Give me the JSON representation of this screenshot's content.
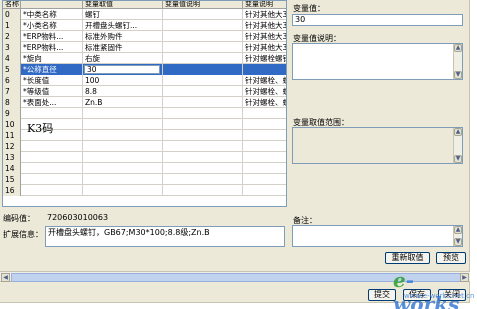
{
  "grid": {
    "columns": [
      "名称",
      "变量取值",
      "变量值说明",
      "变量说明"
    ],
    "rows": [
      {
        "num": "0",
        "name": "*中类名称",
        "value": "螺钉",
        "value_desc": "",
        "var_desc": "针对其他大3"
      },
      {
        "num": "1",
        "name": "*小类名称",
        "value": "开槽盘头螺钉...",
        "value_desc": "",
        "var_desc": "针对其他大3"
      },
      {
        "num": "2",
        "name": "*ERP物料...",
        "value": "标准外购件",
        "value_desc": "",
        "var_desc": "针对其他大3"
      },
      {
        "num": "3",
        "name": "*ERP物料...",
        "value": "标准紧固件",
        "value_desc": "",
        "var_desc": "针对其他大3"
      },
      {
        "num": "4",
        "name": "*旋向",
        "value": "右旋",
        "value_desc": "",
        "var_desc": "针对螺栓螺钉"
      },
      {
        "num": "5",
        "name": "*公称直径",
        "value": "30",
        "value_desc": "",
        "var_desc": ""
      },
      {
        "num": "6",
        "name": "*长度值",
        "value": "100",
        "value_desc": "",
        "var_desc": "针对螺栓、螺"
      },
      {
        "num": "7",
        "name": "*等级值",
        "value": "8.8",
        "value_desc": "",
        "var_desc": "针对螺栓、螺"
      },
      {
        "num": "8",
        "name": "*表面处...",
        "value": "Zn.B",
        "value_desc": "",
        "var_desc": "针对螺栓、螺"
      },
      {
        "num": "9",
        "name": "",
        "value": "",
        "value_desc": "",
        "var_desc": ""
      },
      {
        "num": "10",
        "name": "",
        "value": "",
        "value_desc": "",
        "var_desc": ""
      },
      {
        "num": "11",
        "name": "",
        "value": "",
        "value_desc": "",
        "var_desc": ""
      },
      {
        "num": "12",
        "name": "",
        "value": "",
        "value_desc": "",
        "var_desc": ""
      },
      {
        "num": "13",
        "name": "",
        "value": "",
        "value_desc": "",
        "var_desc": ""
      },
      {
        "num": "14",
        "name": "",
        "value": "",
        "value_desc": "",
        "var_desc": ""
      },
      {
        "num": "15",
        "name": "",
        "value": "",
        "value_desc": "",
        "var_desc": ""
      },
      {
        "num": "16",
        "name": "",
        "value": "",
        "value_desc": "",
        "var_desc": ""
      }
    ],
    "selected_row": 5,
    "k3_note": "K3码"
  },
  "right_panel": {
    "variable_value_label": "变量值：",
    "variable_value": "30",
    "value_desc_label": "变量值说明：",
    "value_range_label": "变量取值范围：",
    "remark_label": "备注："
  },
  "bottom": {
    "code_label": "编码值：",
    "code_value": "720603010063",
    "ext_label": "扩展信息：",
    "ext_value": "开槽盘头螺钉，GB67;M30*100;8.8级;Zn.B"
  },
  "buttons": {
    "reset_value": "重新取值",
    "preview": "预览",
    "submit": "提交",
    "save": "保存",
    "close": "关闭"
  },
  "watermark": {
    "logo": "e-works",
    "sub": "www.e-works.net.cn"
  },
  "colors": {
    "selection": "#316ac5",
    "panel_bg": "#ece9d8",
    "border": "#7f9db9"
  }
}
